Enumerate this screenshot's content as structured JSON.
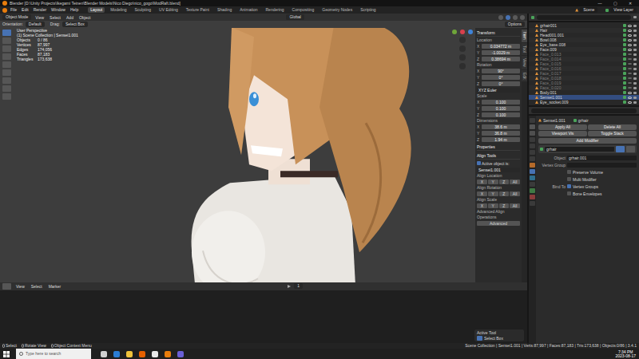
{
  "window": {
    "title": "Blender [D:\\Unity Projects\\Ikegami Teinen\\Blender Models\\Nico Diego\\nico_gogo\\ModRaft.blend]",
    "controls": [
      "—",
      "▢",
      "✕"
    ]
  },
  "menu": [
    "File",
    "Edit",
    "Render",
    "Window",
    "Help"
  ],
  "workspaces": [
    {
      "label": "Layout",
      "selected": true
    },
    {
      "label": "Modeling",
      "selected": false
    },
    {
      "label": "Sculpting",
      "selected": false
    },
    {
      "label": "UV Editing",
      "selected": false
    },
    {
      "label": "Texture Paint",
      "selected": false
    },
    {
      "label": "Shading",
      "selected": false
    },
    {
      "label": "Animation",
      "selected": false
    },
    {
      "label": "Rendering",
      "selected": false
    },
    {
      "label": "Compositing",
      "selected": false
    },
    {
      "label": "Geometry Nodes",
      "selected": false
    },
    {
      "label": "Scripting",
      "selected": false
    }
  ],
  "scene": "Scene",
  "view_layer": "View Layer",
  "viewport_header": {
    "mode": "Object Mode",
    "menus": [
      "View",
      "Select",
      "Add",
      "Object"
    ],
    "transform": "Global"
  },
  "tool_settings": {
    "orientation_label": "Orientation:",
    "orientation": "Default",
    "drag_label": "Drag:",
    "drag": "Select Box",
    "options": "Options"
  },
  "toolbar": [
    {
      "selected": true
    },
    {
      "selected": false
    },
    {
      "selected": false
    },
    {
      "selected": false
    },
    {
      "selected": false
    },
    {
      "selected": false
    },
    {
      "selected": false
    },
    {
      "selected": false
    },
    {
      "selected": false
    }
  ],
  "overlay": {
    "title": "User Perspective",
    "collection": "(1) Scene Collection | Sensei1.001",
    "stats": [
      {
        "label": "Objects",
        "value": "0 / 86"
      },
      {
        "label": "Vertices",
        "value": "87,997"
      },
      {
        "label": "Edges",
        "value": "174,056"
      },
      {
        "label": "Faces",
        "value": "87,183"
      },
      {
        "label": "Triangles",
        "value": "173,638"
      }
    ]
  },
  "npanel": {
    "tabs": [
      {
        "label": "Item",
        "selected": true
      },
      {
        "label": "Tool",
        "selected": false
      },
      {
        "label": "View",
        "selected": false
      },
      {
        "label": "Edit",
        "selected": false
      }
    ],
    "sections": [
      {
        "title": "Transform",
        "rows": [
          {
            "kind": "label",
            "text": "Location"
          },
          {
            "kind": "field",
            "axis": "X",
            "value": "0.034772 m"
          },
          {
            "kind": "field",
            "axis": "Y",
            "value": "-1.0029 m"
          },
          {
            "kind": "field",
            "axis": "Z",
            "value": "0.38694 m"
          },
          {
            "kind": "label",
            "text": "Rotation"
          },
          {
            "kind": "field",
            "axis": "X",
            "value": "90°"
          },
          {
            "kind": "field",
            "axis": "Y",
            "value": "0°"
          },
          {
            "kind": "field",
            "axis": "Z",
            "value": "0°"
          },
          {
            "kind": "select",
            "text": "XYZ Euler"
          },
          {
            "kind": "label",
            "text": "Scale"
          },
          {
            "kind": "field",
            "axis": "X",
            "value": "0.100"
          },
          {
            "kind": "field",
            "axis": "Y",
            "value": "0.100"
          },
          {
            "kind": "field",
            "axis": "Z",
            "value": "0.100"
          },
          {
            "kind": "label",
            "text": "Dimensions"
          },
          {
            "kind": "field",
            "axis": "X",
            "value": "38.6 m"
          },
          {
            "kind": "field",
            "axis": "Y",
            "value": "36.8 m"
          },
          {
            "kind": "field",
            "axis": "Z",
            "value": "1.94 m"
          }
        ]
      },
      {
        "title": "Properties",
        "rows": []
      },
      {
        "title": "Align Tools",
        "rows": [
          {
            "kind": "check",
            "text": "Active object is:",
            "checked": true
          },
          {
            "kind": "select",
            "text": "Sensei1.001"
          },
          {
            "kind": "label",
            "text": "Align Location"
          },
          {
            "kind": "axes",
            "items": [
              "X",
              "Y",
              "Z",
              "All"
            ]
          },
          {
            "kind": "label",
            "text": "Align Rotation"
          },
          {
            "kind": "axes",
            "items": [
              "X",
              "Y",
              "Z",
              "All"
            ]
          },
          {
            "kind": "label",
            "text": "Align Scale"
          },
          {
            "kind": "axes",
            "items": [
              "X",
              "Y",
              "Z",
              "All"
            ]
          },
          {
            "kind": "label",
            "text": "Advanced Align Operations"
          },
          {
            "kind": "button",
            "text": "Advanced"
          }
        ]
      }
    ]
  },
  "outliner": {
    "items": [
      {
        "name": "grhair001",
        "visible": true,
        "selected": false
      },
      {
        "name": "Hair",
        "visible": true,
        "selected": false
      },
      {
        "name": "Head001.001",
        "visible": true,
        "selected": false
      },
      {
        "name": "Bowl.008",
        "visible": true,
        "selected": false
      },
      {
        "name": "Eye_base.008",
        "visible": true,
        "selected": false
      },
      {
        "name": "Face.009",
        "visible": true,
        "selected": false
      },
      {
        "name": "Face_0.013",
        "visible": false,
        "selected": false
      },
      {
        "name": "Face_0.014",
        "visible": false,
        "selected": false
      },
      {
        "name": "Face_0.015",
        "visible": false,
        "selected": false
      },
      {
        "name": "Face_0.016",
        "visible": false,
        "selected": false
      },
      {
        "name": "Face_0.017",
        "visible": false,
        "selected": false
      },
      {
        "name": "Face_0.018",
        "visible": false,
        "selected": false
      },
      {
        "name": "Face_0.019",
        "visible": false,
        "selected": false
      },
      {
        "name": "Face_0.020",
        "visible": false,
        "selected": false
      },
      {
        "name": "Body.001",
        "visible": true,
        "selected": false
      },
      {
        "name": "Sensei1.001",
        "visible": true,
        "selected": true
      },
      {
        "name": "Eye_socket.009",
        "visible": true,
        "selected": false
      }
    ]
  },
  "properties": {
    "tabs": [
      {
        "selected": false
      },
      {
        "selected": false
      },
      {
        "selected": false
      },
      {
        "selected": false
      },
      {
        "selected": false
      },
      {
        "selected": false
      },
      {
        "selected": false
      },
      {
        "selected": false
      },
      {
        "selected": true
      },
      {
        "selected": false
      },
      {
        "selected": false
      },
      {
        "selected": false
      },
      {
        "selected": false
      },
      {
        "selected": false
      }
    ],
    "object": "Sensei1.001",
    "modifier_target": "grhair",
    "tools": [
      "Apply All",
      "Delete All",
      "Viewport Vis",
      "Toggle Stack"
    ],
    "add_modifier": "Add Modifier",
    "modifier": {
      "name": "grhair",
      "rows": [
        {
          "kind": "field",
          "label": "Object",
          "value": "grhair.001"
        },
        {
          "kind": "empty",
          "label": "Vertex Group"
        },
        {
          "kind": "check",
          "text": "Preserve Volume",
          "checked": false
        },
        {
          "kind": "check",
          "text": "Multi Modifier",
          "checked": false
        },
        {
          "kind": "check",
          "label": "Bind To",
          "text": "Vertex Groups",
          "checked": true
        },
        {
          "kind": "check",
          "text": "Bone Envelopes",
          "checked": false
        }
      ]
    }
  },
  "timeline": {
    "menus": [
      "View",
      "Select",
      "Marker"
    ],
    "frame": "1"
  },
  "active_tool": {
    "title": "Active Tool",
    "tool": "Select Box"
  },
  "status": {
    "hints": [
      "Select",
      "Rotate View",
      "Object Context Menu"
    ],
    "info": "Scene Collection | Sensei1.001 | Verts:87,997 | Faces:87,183 | Tris:173,638 | Objects:0/86 | 3.4.1"
  },
  "taskbar": {
    "search": "Type here to search",
    "time": "7:34 PM",
    "date": "2023-08-17"
  }
}
